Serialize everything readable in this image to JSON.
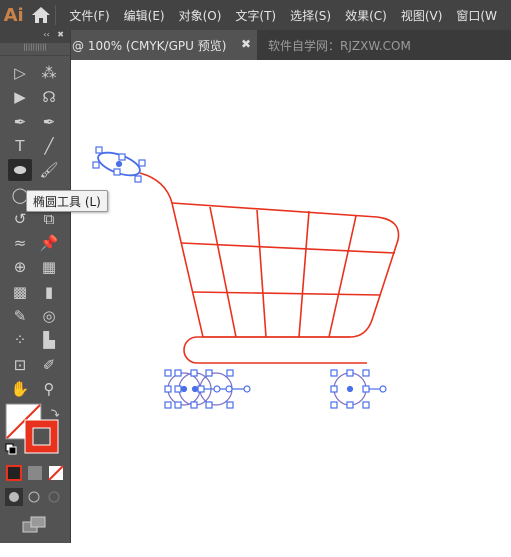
{
  "app": {
    "logo": "Ai"
  },
  "menu": [
    "文件(F)",
    "编辑(E)",
    "对象(O)",
    "文字(T)",
    "选择(S)",
    "效果(C)",
    "视图(V)",
    "窗口(W"
  ],
  "tabs": {
    "active": "@ 100% (CMYK/GPU 预览)",
    "close": "✖",
    "other": "软件自学网：RJZXW.COM"
  },
  "toolbar": {
    "collapse": "‹‹",
    "close": "✖",
    "grip": "||||||||||",
    "tools": [
      {
        "name": "direct-selection-tool",
        "glyph": "▷"
      },
      {
        "name": "magic-wand-tool",
        "glyph": "⁂"
      },
      {
        "name": "selection-tool",
        "glyph": "▶"
      },
      {
        "name": "lasso-tool",
        "glyph": "☊"
      },
      {
        "name": "pen-tool",
        "glyph": "✒"
      },
      {
        "name": "curvature-tool",
        "glyph": "✒"
      },
      {
        "name": "type-tool",
        "glyph": "T"
      },
      {
        "name": "line-tool",
        "glyph": "╱"
      },
      {
        "name": "ellipse-tool",
        "glyph": "⬬"
      },
      {
        "name": "paintbrush-tool",
        "glyph": "🖌"
      },
      {
        "name": "shaper-tool",
        "glyph": "◯"
      },
      {
        "name": "eraser-tool",
        "glyph": "◆"
      },
      {
        "name": "rotate-tool",
        "glyph": "↺"
      },
      {
        "name": "scale-tool",
        "glyph": "⧉"
      },
      {
        "name": "warp-tool",
        "glyph": "≈"
      },
      {
        "name": "pin-tool",
        "glyph": "📌"
      },
      {
        "name": "shape-builder-tool",
        "glyph": "⊕"
      },
      {
        "name": "perspective-grid-tool",
        "glyph": "▦"
      },
      {
        "name": "mesh-tool",
        "glyph": "▩"
      },
      {
        "name": "gradient-tool",
        "glyph": "▮"
      },
      {
        "name": "eyedropper-tool",
        "glyph": "✎"
      },
      {
        "name": "blend-tool",
        "glyph": "◎"
      },
      {
        "name": "symbol-sprayer-tool",
        "glyph": "⁘"
      },
      {
        "name": "column-graph-tool",
        "glyph": "▙"
      },
      {
        "name": "artboard-tool",
        "glyph": "⊡"
      },
      {
        "name": "slice-tool",
        "glyph": "✐"
      },
      {
        "name": "hand-tool",
        "glyph": "✋"
      },
      {
        "name": "zoom-tool",
        "glyph": "⚲"
      }
    ],
    "selected_tool": "ellipse-tool"
  },
  "tooltip": "椭圆工具 (L)",
  "colors": {
    "stroke": "#e8321e",
    "selection": "#4b6fe8",
    "fill": "none"
  }
}
